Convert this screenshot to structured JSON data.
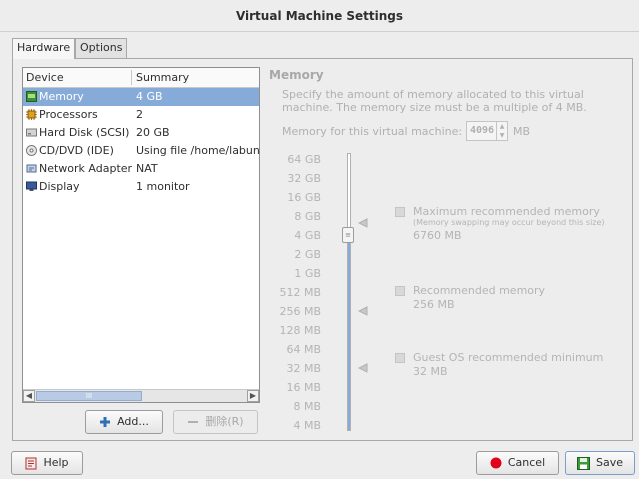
{
  "window": {
    "title": "Virtual Machine Settings"
  },
  "tabs": [
    {
      "label": "Hardware",
      "active": true
    },
    {
      "label": "Options",
      "active": false
    }
  ],
  "devices": {
    "columns": {
      "device": "Device",
      "summary": "Summary"
    },
    "rows": [
      {
        "name": "Memory",
        "summary": "4 GB",
        "icon": "memory-icon",
        "selected": true
      },
      {
        "name": "Processors",
        "summary": "2",
        "icon": "processor-icon",
        "selected": false
      },
      {
        "name": "Hard Disk (SCSI)",
        "summary": "20 GB",
        "icon": "hard-disk-icon",
        "selected": false
      },
      {
        "name": "CD/DVD (IDE)",
        "summary": "Using file /home/labuni",
        "icon": "cd-dvd-icon",
        "selected": false
      },
      {
        "name": "Network Adapter",
        "summary": "NAT",
        "icon": "network-adapter-icon",
        "selected": false
      },
      {
        "name": "Display",
        "summary": "1 monitor",
        "icon": "display-icon",
        "selected": false
      }
    ],
    "scroll_thumb": "III"
  },
  "buttons": {
    "add": "Add...",
    "remove": "删除(R)",
    "help": "Help",
    "cancel": "Cancel",
    "save": "Save"
  },
  "memory": {
    "title": "Memory",
    "description": "Specify the amount of memory allocated to this virtual machine. The memory size must be a multiple of 4 MB.",
    "for_vm_label": "Memory for this virtual machine:",
    "value": "4096",
    "unit": "MB",
    "scale": [
      "64 GB",
      "32 GB",
      "16 GB",
      "8 GB",
      "4 GB",
      "2 GB",
      "1 GB",
      "512 MB",
      "256 MB",
      "128 MB",
      "64 MB",
      "32 MB",
      "16 MB",
      "8 MB",
      "4 MB"
    ],
    "max_recommended": {
      "label": "Maximum recommended memory",
      "note": "(Memory swapping may occur beyond this size)",
      "value": "6760 MB"
    },
    "recommended": {
      "label": "Recommended memory",
      "value": "256 MB"
    },
    "guest_min": {
      "label": "Guest OS recommended minimum",
      "value": "32 MB"
    }
  },
  "colors": {
    "selection": "#86abd9",
    "disabled_text": "#b0b0b0",
    "cancel_red": "#e0001b",
    "save_green": "#3c9a3c"
  }
}
